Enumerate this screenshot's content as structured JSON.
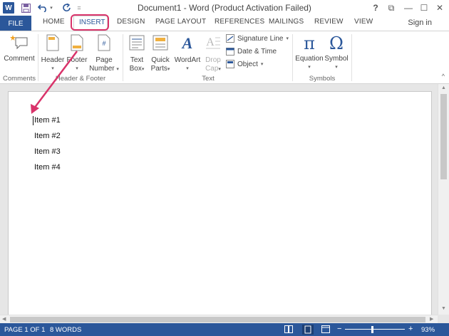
{
  "window": {
    "title": "Document1 - Word (Product Activation Failed)",
    "help": "?",
    "restore_ribbon": "⧉",
    "minimize": "—",
    "maximize": "☐",
    "close": "✕",
    "sign_in": "Sign in"
  },
  "quick_access": {
    "app_icon": "W",
    "save_icon": "save-icon",
    "undo_icon": "undo-icon",
    "redo_icon": "redo-icon",
    "customize": "="
  },
  "tabs": [
    "FILE",
    "HOME",
    "INSERT",
    "DESIGN",
    "PAGE LAYOUT",
    "REFERENCES",
    "MAILINGS",
    "REVIEW",
    "VIEW"
  ],
  "ribbon": {
    "comments": {
      "comment": "Comment",
      "group": "Comments"
    },
    "header_footer": {
      "header": "Header",
      "footer": "Footer",
      "page_number_1": "Page",
      "page_number_2": "Number",
      "group": "Header & Footer"
    },
    "text": {
      "text_box_1": "Text",
      "text_box_2": "Box",
      "quick_parts_1": "Quick",
      "quick_parts_2": "Parts",
      "wordart": "WordArt",
      "drop_cap_1": "Drop",
      "drop_cap_2": "Cap",
      "signature_line": "Signature Line",
      "date_time": "Date & Time",
      "object": "Object",
      "group": "Text"
    },
    "symbols": {
      "equation": "Equation",
      "symbol": "Symbol",
      "equation_glyph": "π",
      "symbol_glyph": "Ω",
      "group": "Symbols"
    },
    "collapse": "^"
  },
  "document": {
    "items": [
      "Item #1",
      "Item #2",
      "Item #3",
      "Item #4"
    ]
  },
  "status": {
    "page": "PAGE 1 OF 1",
    "words": "8 WORDS",
    "zoom_minus": "−",
    "zoom_plus": "+",
    "zoom": "93%",
    "zoom_level": 0.93
  },
  "colors": {
    "accent": "#2b579a",
    "highlight": "#d9336a"
  }
}
